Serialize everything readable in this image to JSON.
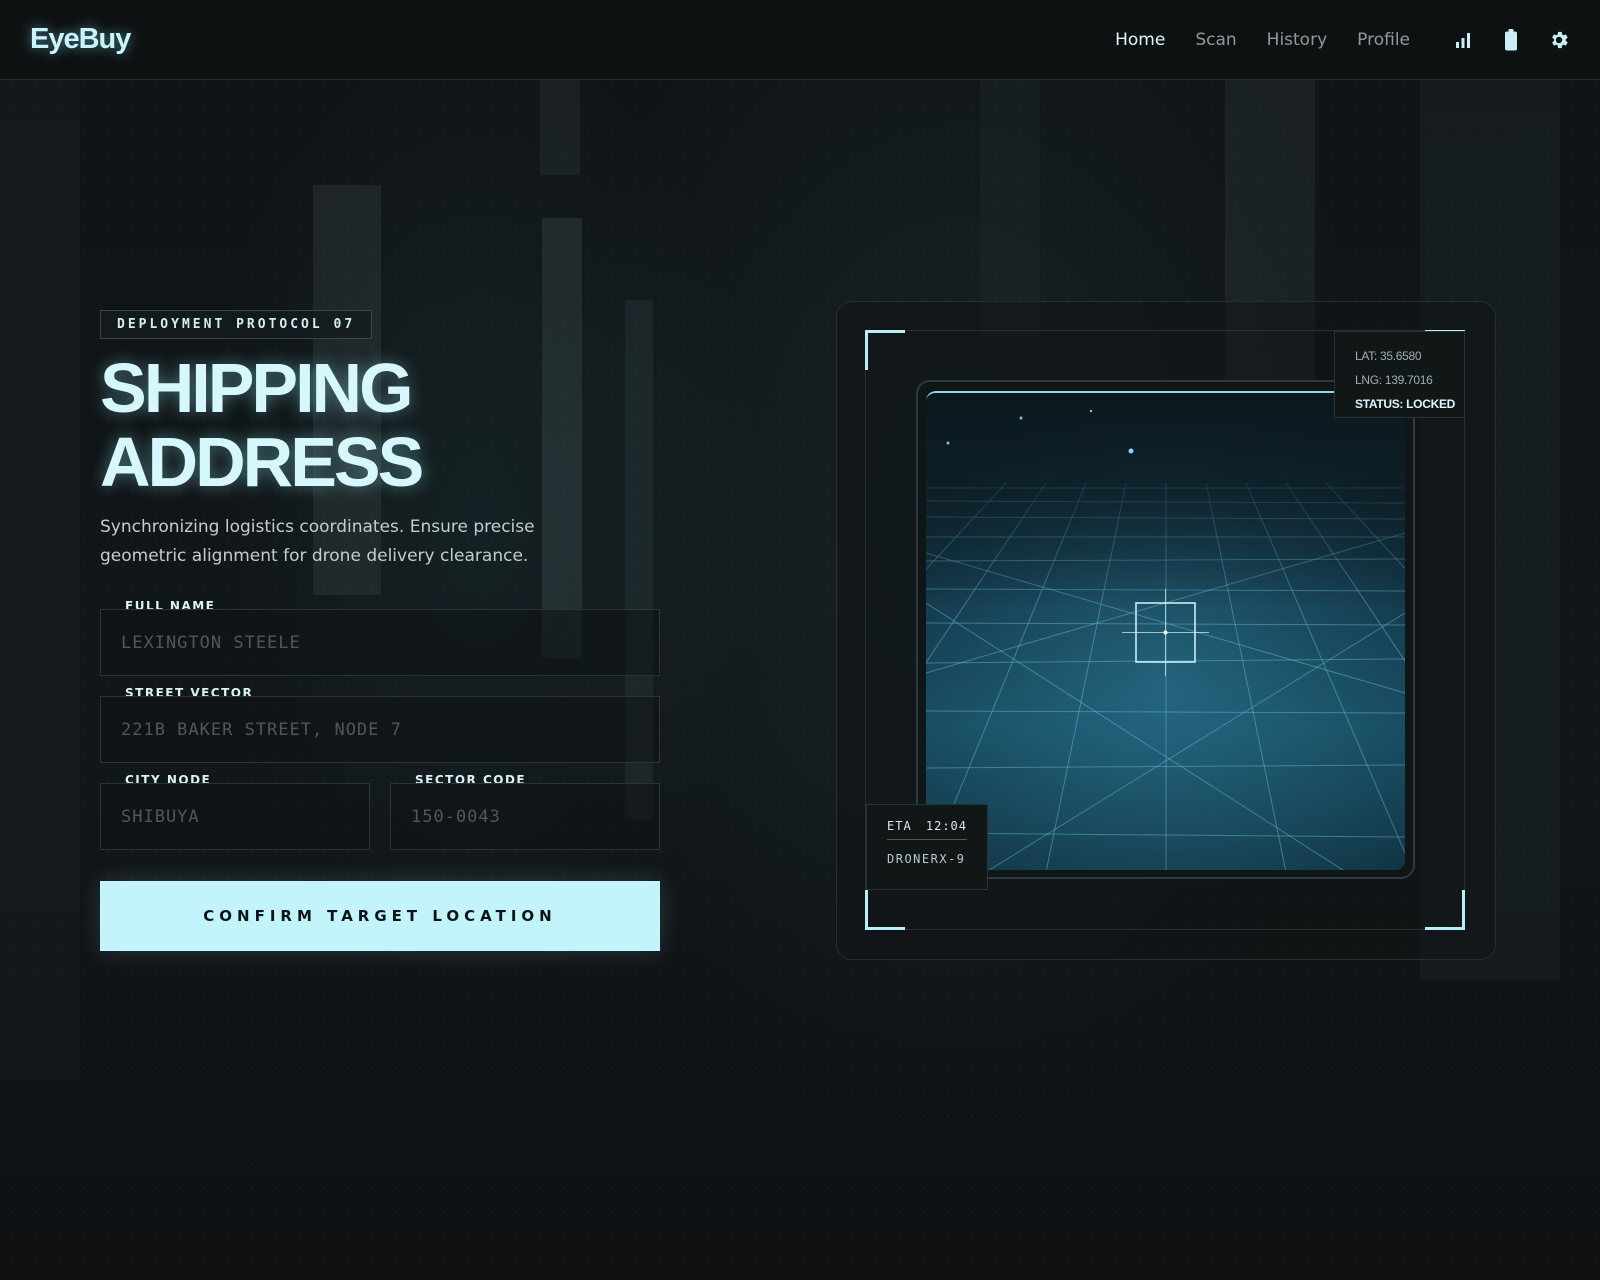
{
  "app": {
    "logo": "EyeBuy"
  },
  "nav": {
    "links": [
      {
        "label": "Home",
        "active": true
      },
      {
        "label": "Scan",
        "active": false
      },
      {
        "label": "History",
        "active": false
      },
      {
        "label": "Profile",
        "active": false
      }
    ],
    "icons": [
      "signal-bars-icon",
      "battery-icon",
      "gear-icon"
    ]
  },
  "form": {
    "tag": "DEPLOYMENT PROTOCOL 07",
    "title_line1": "SHIPPING",
    "title_line2": "ADDRESS",
    "description": "Synchronizing logistics coordinates. Ensure precise geometric alignment for drone delivery clearance.",
    "full_name": {
      "label": "FULL NAME",
      "placeholder": "LEXINGTON STEELE",
      "value": ""
    },
    "street": {
      "label": "STREET VECTOR",
      "placeholder": "221B BAKER STREET, NODE 7",
      "value": ""
    },
    "city": {
      "label": "CITY NODE",
      "placeholder": "SHIBUYA",
      "value": ""
    },
    "sector": {
      "label": "SECTOR CODE",
      "placeholder": "150-0043",
      "value": ""
    },
    "submit_label": "CONFIRM TARGET LOCATION"
  },
  "scanner": {
    "lat": "LAT: 35.6580",
    "lng": "LNG: 139.7016",
    "status": "STATUS: LOCKED",
    "eta_label": "ETA",
    "eta_value": "12:04",
    "drone_id": "DRONERX-9"
  },
  "colors": {
    "accent": "#c3f4fb",
    "background": "#0f1214",
    "border": "#2b3335"
  }
}
